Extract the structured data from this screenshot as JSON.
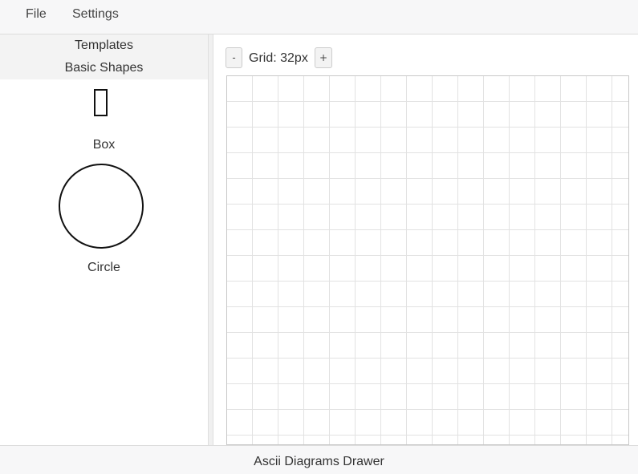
{
  "menubar": {
    "items": [
      {
        "label": "File"
      },
      {
        "label": "Settings"
      }
    ]
  },
  "sidebar": {
    "header": "Templates",
    "category": "Basic Shapes",
    "shapes": [
      {
        "label": "Box",
        "icon": "rectangle-shape-icon"
      },
      {
        "label": "Circle",
        "icon": "circle-shape-icon"
      }
    ]
  },
  "toolbar": {
    "zoom_out_label": "-",
    "grid_label": "Grid: 32px",
    "zoom_in_label": "+"
  },
  "canvas": {
    "grid_size": 32
  },
  "footer": {
    "title": "Ascii Diagrams Drawer"
  },
  "colors": {
    "menubar_bg": "#f7f7f8",
    "grid_line": "#e2e2e2",
    "shape_stroke": "#111111"
  }
}
